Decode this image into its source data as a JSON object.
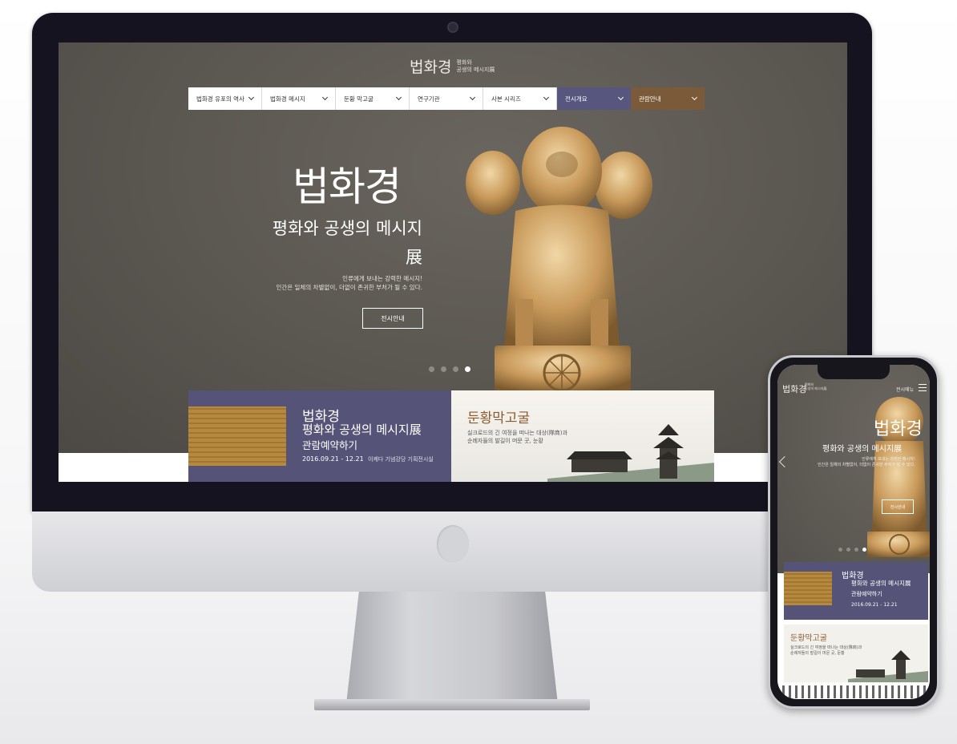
{
  "site": {
    "logo_main": "법화경",
    "logo_sub_1": "평화와",
    "logo_sub_2": "공생의 메시지展"
  },
  "nav": {
    "items": [
      {
        "label": "법화경 유포의 역사"
      },
      {
        "label": "법화경 메시지"
      },
      {
        "label": "둔황 막고굴"
      },
      {
        "label": "연구기관"
      },
      {
        "label": "사본 시리즈"
      },
      {
        "label": "전시개요"
      },
      {
        "label": "관람안내"
      }
    ]
  },
  "hero": {
    "title": "법화경",
    "subtitle": "평화와 공생의 메시지",
    "exhibition_char": "展",
    "desc_line1": "인류에게 보내는 강력한 메시지!",
    "desc_line2": "인간은 일체의 차별없이, 더없이 존귀한 부처가 될 수 있다.",
    "button_label": "전시안내"
  },
  "card_reservation": {
    "title": "법화경",
    "subtitle": "평화와 공생의 메시지展",
    "action": "관람예약하기",
    "dates": "2016.09.21 - 12.21",
    "venue": "이케다 기념강당 기획전시실"
  },
  "card_dunhuang": {
    "title": "둔황막고굴",
    "desc_line1": "실크로드의 긴 여정을 떠나는 대상(隊商)과",
    "desc_line2": "순례자들의 발길이 머문 곳, 눈황"
  },
  "mobile": {
    "menu_label": "전시메뉴",
    "hero_title": "법화경",
    "hero_subtitle": "평화와 공생의 메시지展",
    "desc_line1": "인류에게 보내는 강력한 메시지!",
    "desc_line2": "인간은 일체의 차별없이, 더없이 존귀한 부처가 될 수 있다.",
    "button_label": "전시안내",
    "card1_title": "법화경",
    "card1_subtitle": "평화와 공생의 메시지展",
    "card1_action": "관람예약하기",
    "card1_dates": "2016.09.21 - 12.21",
    "card2_title": "둔황막고굴",
    "card2_desc_line1": "실크로드의 긴 여정을 떠나는 대상(隊商)과",
    "card2_desc_line2": "순례자들의 발길이 머문 곳, 둔황"
  },
  "colors": {
    "background_warm_gray": "#5a5651",
    "nav_purple": "#56567e",
    "nav_brown": "#7a5a38",
    "card_purple": "#555478",
    "accent_brown_text": "#8a5a32"
  },
  "carousel": {
    "active_slide": 4,
    "slides": 4
  }
}
